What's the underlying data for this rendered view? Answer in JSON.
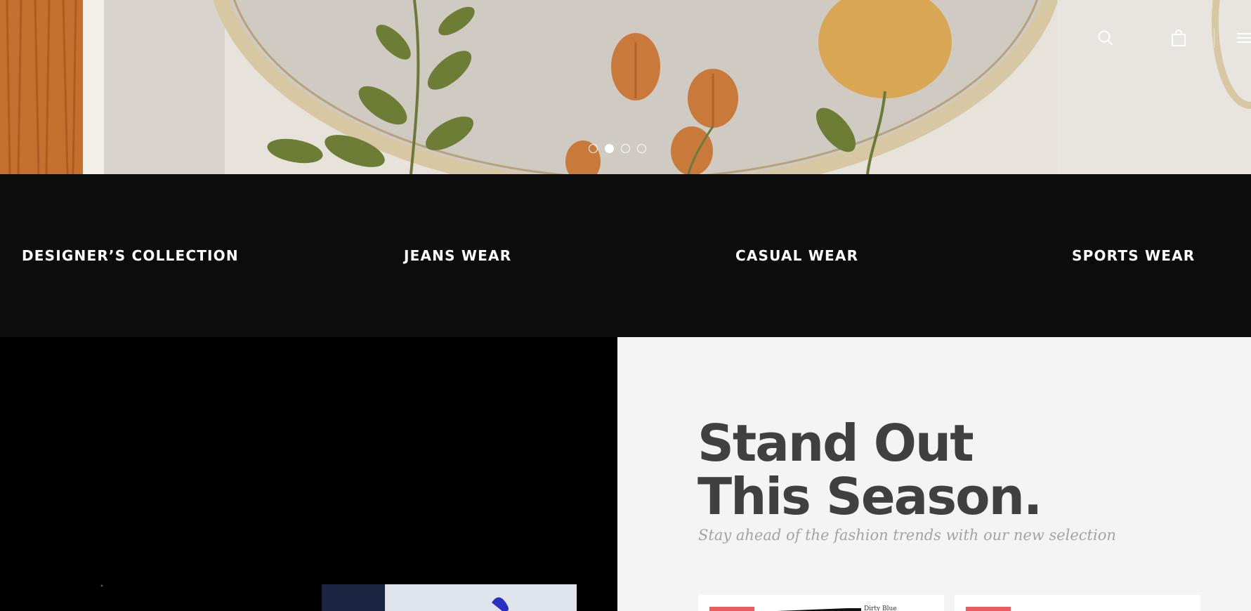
{
  "hero": {
    "slides": [
      {
        "label": "slide 1",
        "active": false
      },
      {
        "label": "slide 2",
        "active": true
      },
      {
        "label": "slide 3",
        "active": false
      },
      {
        "label": "slide 4",
        "active": false
      }
    ]
  },
  "header": {
    "icons": [
      "search-icon",
      "shopping-bag-icon",
      "menu-icon"
    ]
  },
  "categories": [
    {
      "label": "DESIGNER’S COLLECTION"
    },
    {
      "label": "JEANS WEAR"
    },
    {
      "label": "CASUAL WEAR"
    },
    {
      "label": "SPORTS WEAR"
    }
  ],
  "promo": {
    "headline_line1": "Stand Out",
    "headline_line2": "This Season.",
    "subtitle": "Stay ahead of the fashion trends with our new selection"
  },
  "products": [
    {
      "title": "Dirty Blue"
    },
    {
      "title": ""
    }
  ],
  "colors": {
    "dark_band": "#0c0c0c",
    "headline": "#404040",
    "subtitle": "#a3a3a3",
    "badge": "#ef5a5f",
    "panel": "#f4f4f4"
  }
}
